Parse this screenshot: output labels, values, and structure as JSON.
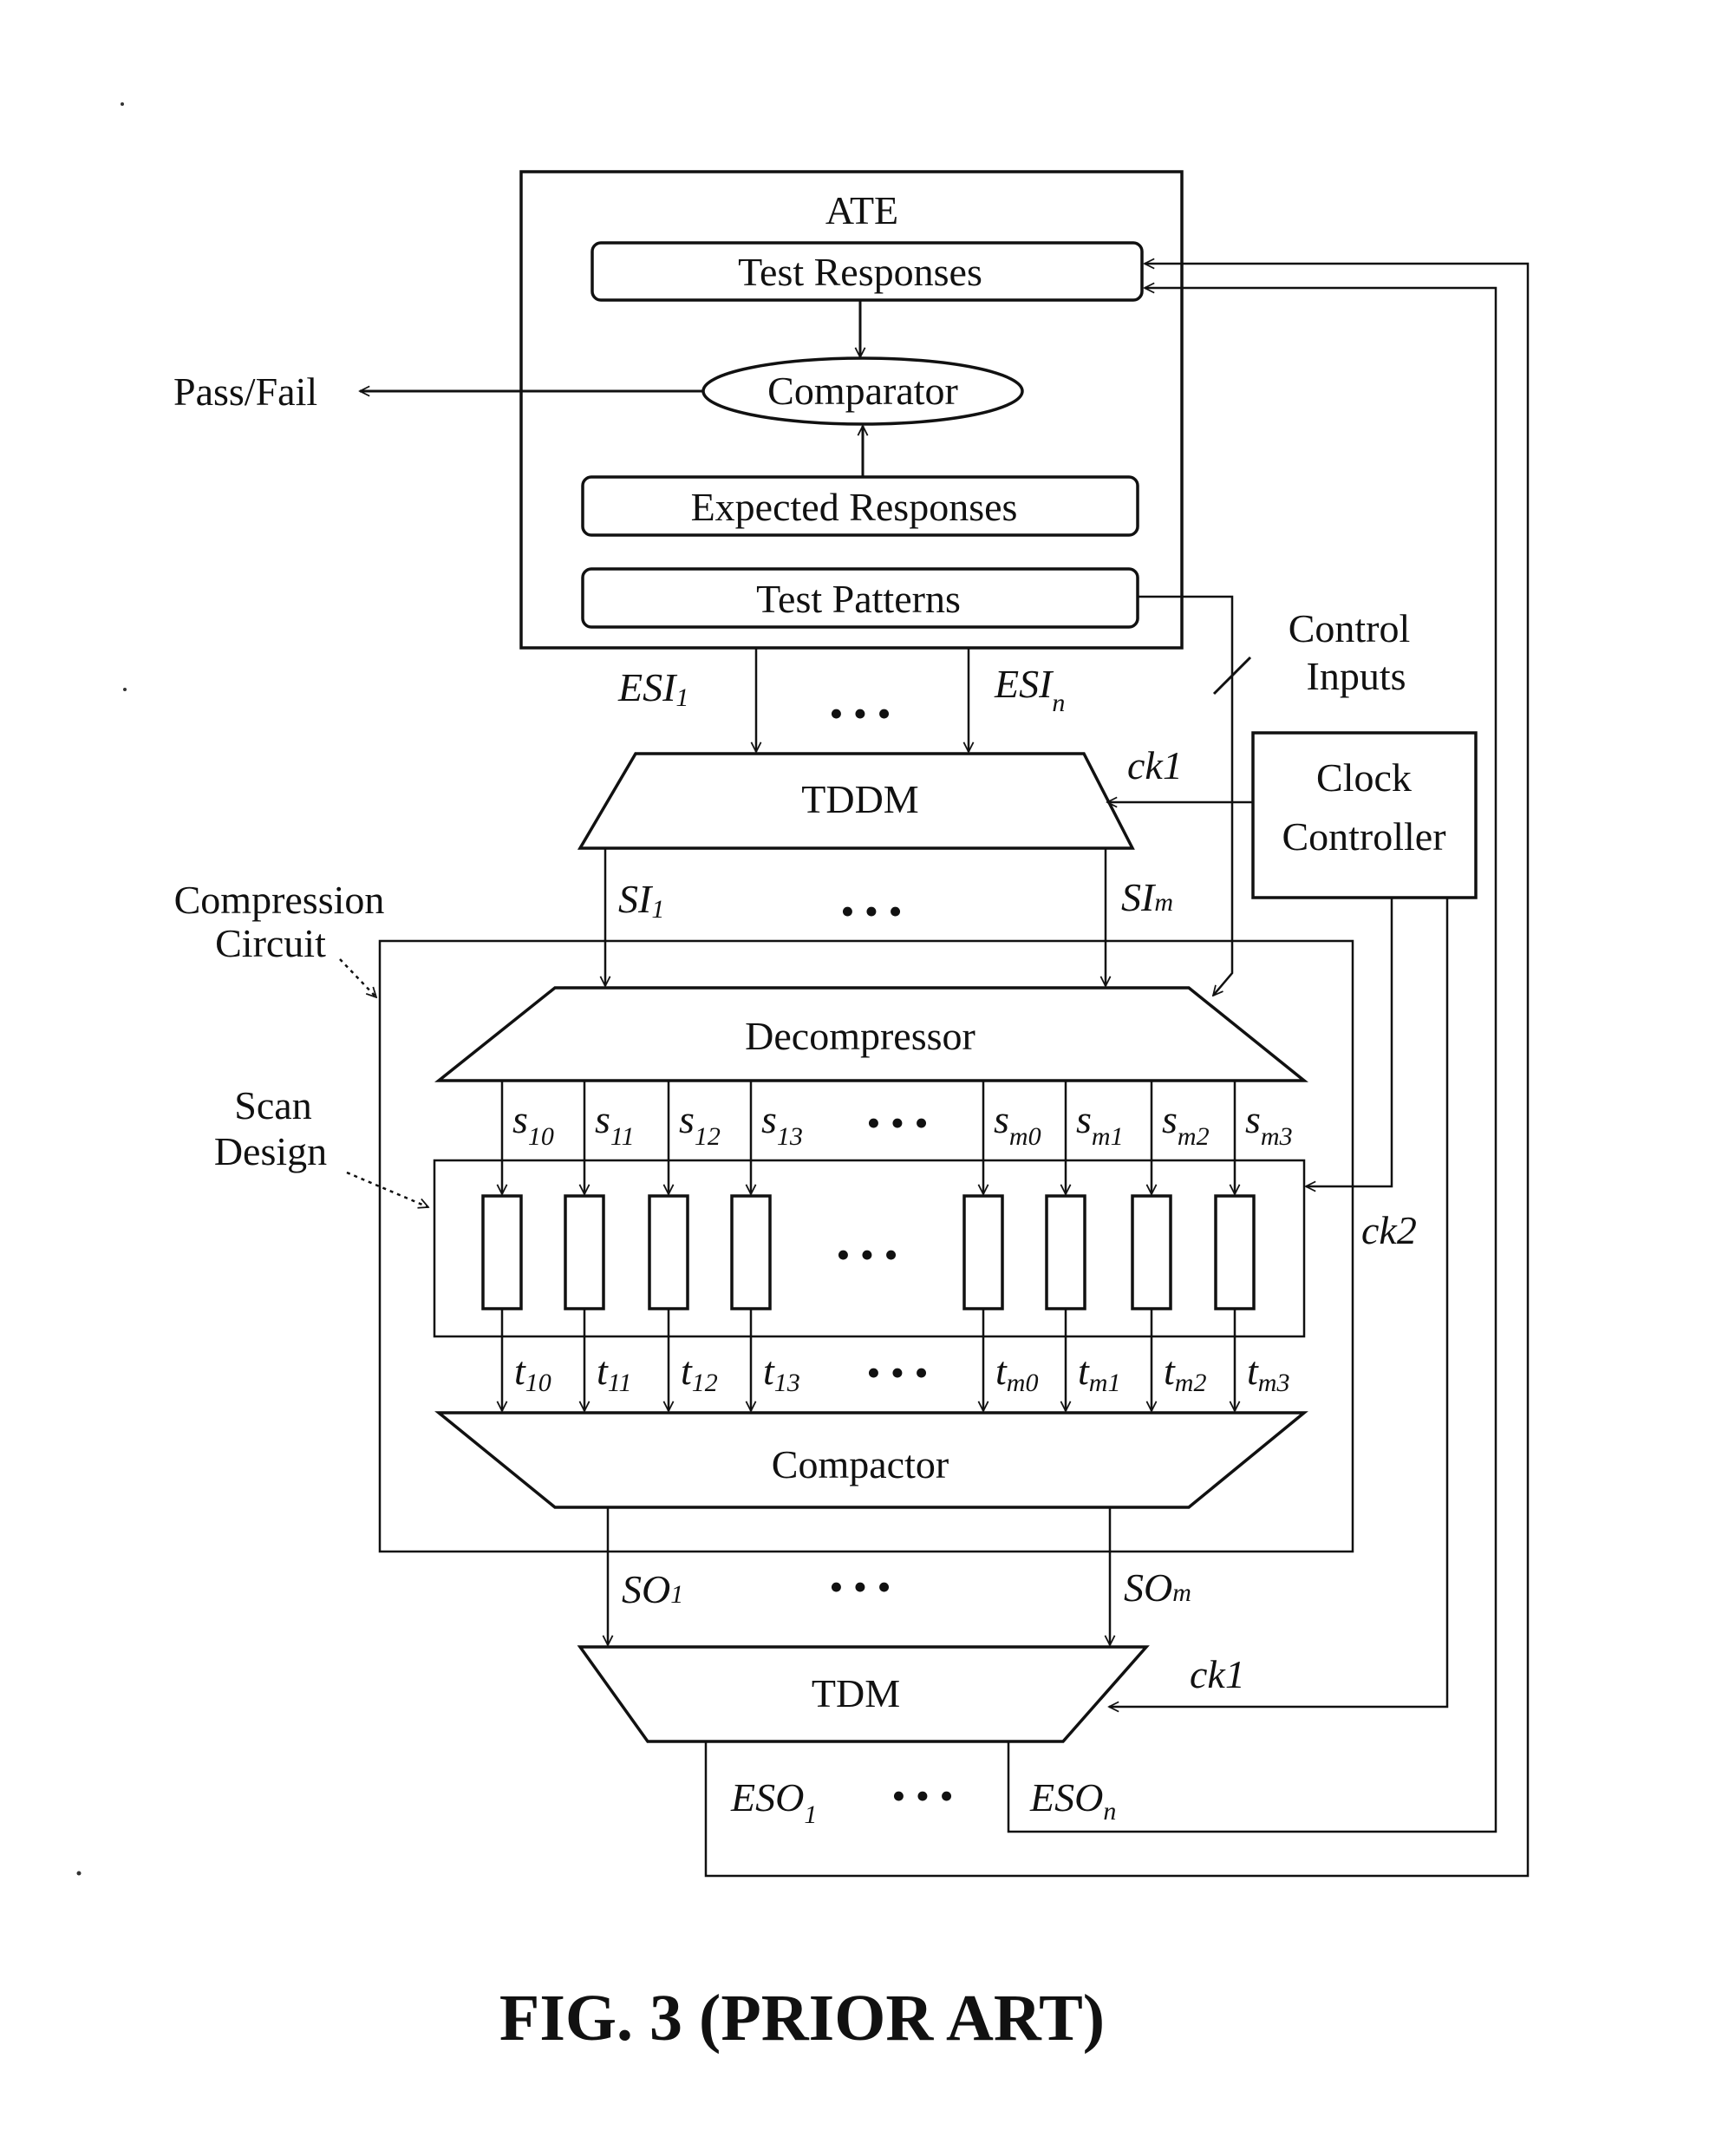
{
  "figure": {
    "caption": "FIG. 3 (PRIOR ART)",
    "ate": {
      "title": "ATE",
      "test_responses": "Test Responses",
      "comparator": "Comparator",
      "expected_responses": "Expected Responses",
      "test_patterns": "Test Patterns"
    },
    "pass_fail": "Pass/Fail",
    "control_inputs": [
      "Control",
      "Inputs"
    ],
    "clock_controller": [
      "Clock",
      "Controller"
    ],
    "esi": {
      "first": "ESI",
      "first_sub": "1",
      "last": "ESI",
      "last_sub": "n",
      "ellipsis": "• • •"
    },
    "tddm": "TDDM",
    "ck1_top": "ck1",
    "si": {
      "first": "SI",
      "first_sub": "1",
      "last": "SI",
      "last_sub": "m",
      "ellipsis": "• • •"
    },
    "compression_circuit": [
      "Compression",
      "Circuit"
    ],
    "decompressor": "Decompressor",
    "scan_design": [
      "Scan",
      "Design"
    ],
    "scan_inputs": [
      {
        "base": "s",
        "sub": "10"
      },
      {
        "base": "s",
        "sub": "11"
      },
      {
        "base": "s",
        "sub": "12"
      },
      {
        "base": "s",
        "sub": "13"
      },
      {
        "base": "s",
        "sub": "m0"
      },
      {
        "base": "s",
        "sub": "m1"
      },
      {
        "base": "s",
        "sub": "m2"
      },
      {
        "base": "s",
        "sub": "m3"
      }
    ],
    "scan_outputs": [
      {
        "base": "t",
        "sub": "10"
      },
      {
        "base": "t",
        "sub": "11"
      },
      {
        "base": "t",
        "sub": "12"
      },
      {
        "base": "t",
        "sub": "13"
      },
      {
        "base": "t",
        "sub": "m0"
      },
      {
        "base": "t",
        "sub": "m1"
      },
      {
        "base": "t",
        "sub": "m2"
      },
      {
        "base": "t",
        "sub": "m3"
      }
    ],
    "chain_ellipsis": "• • •",
    "ck2": "ck2",
    "compactor": "Compactor",
    "so": {
      "first": "SO",
      "first_sub": "1",
      "last": "SO",
      "last_sub": "m",
      "ellipsis": "• • •"
    },
    "tdm": "TDM",
    "ck1_bottom": "ck1",
    "eso": {
      "first": "ESO",
      "first_sub": "1",
      "last": "ESO",
      "last_sub": "n",
      "ellipsis": "• • •"
    }
  }
}
